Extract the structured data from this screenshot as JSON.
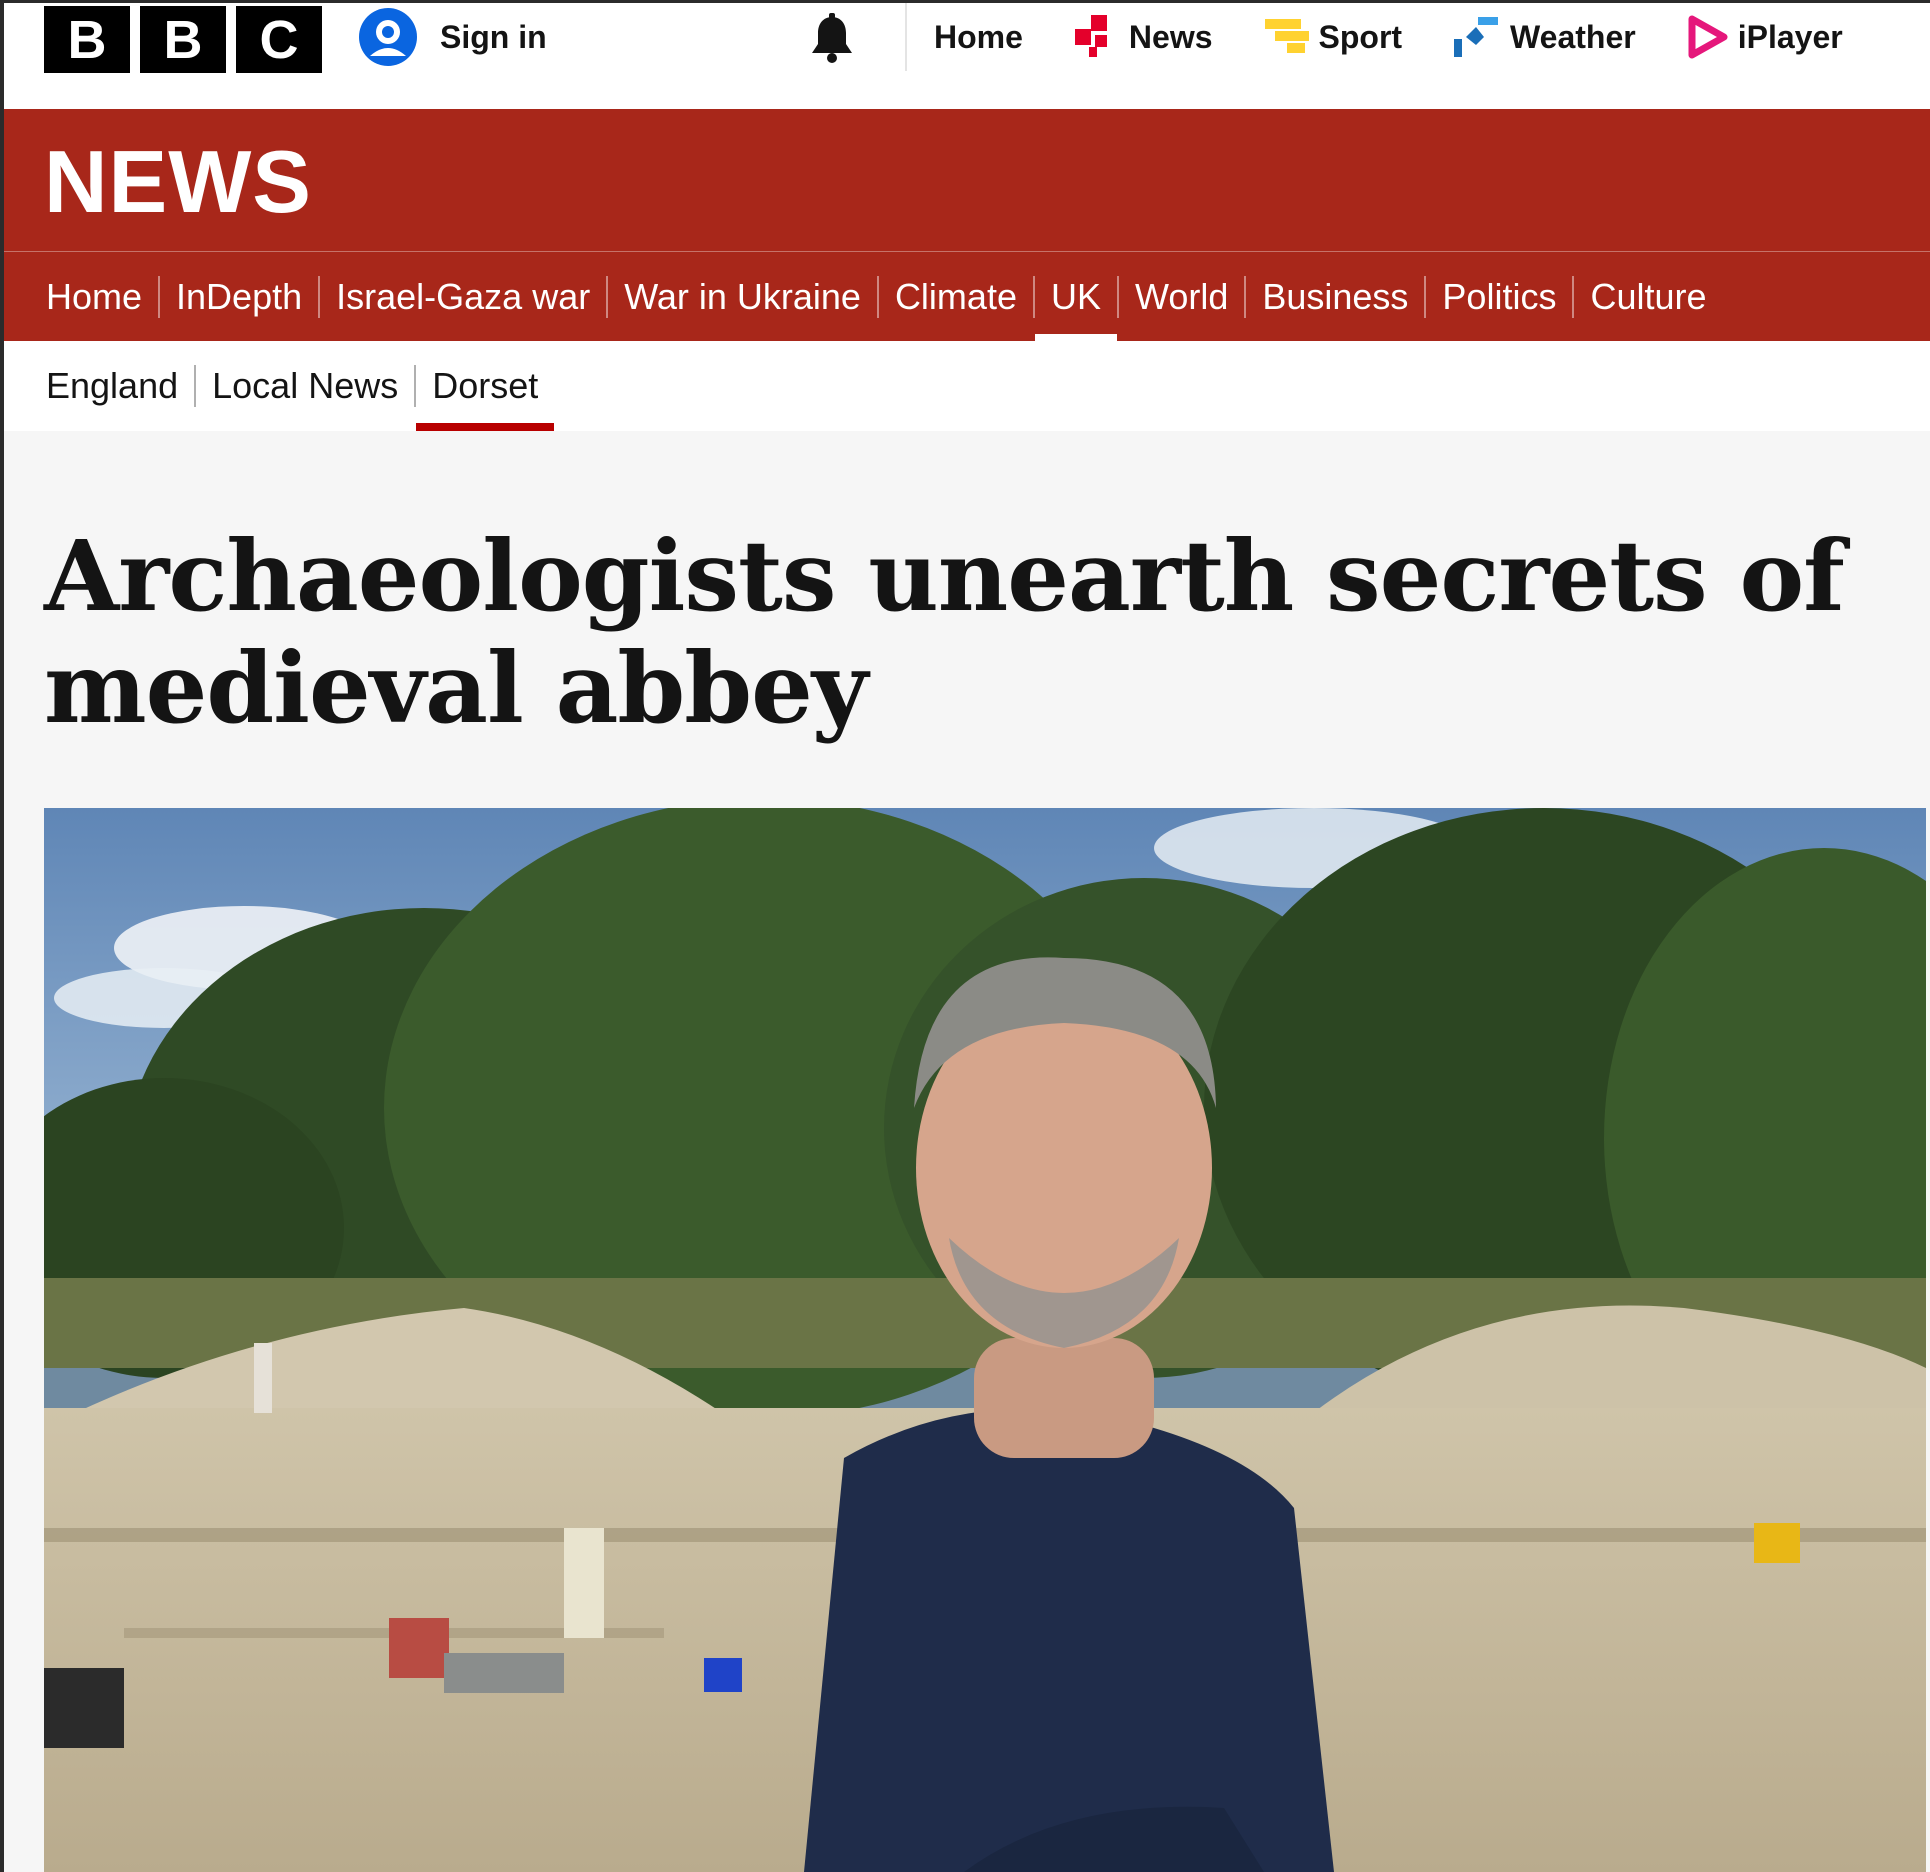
{
  "global_nav": {
    "logo": [
      "B",
      "B",
      "C"
    ],
    "sign_in": "Sign in",
    "links": [
      {
        "label": "Home",
        "icon": "none"
      },
      {
        "label": "News",
        "icon": "news-icon"
      },
      {
        "label": "Sport",
        "icon": "sport-icon"
      },
      {
        "label": "Weather",
        "icon": "weather-icon"
      },
      {
        "label": "iPlayer",
        "icon": "iplayer-icon"
      }
    ]
  },
  "banner": {
    "title": "NEWS",
    "color": "#a8271a"
  },
  "section_nav": {
    "items": [
      "Home",
      "InDepth",
      "Israel-Gaza war",
      "War in Ukraine",
      "Climate",
      "UK",
      "World",
      "Business",
      "Politics",
      "Culture"
    ],
    "active": "UK"
  },
  "sub_nav": {
    "items": [
      "England",
      "Local News",
      "Dorset"
    ],
    "active": "Dorset"
  },
  "article": {
    "headline": "Archaeologists unearth secrets of medieval abbey",
    "image_icon": "photo-excavation-site"
  },
  "colors": {
    "accent_red": "#b80000",
    "brand_black": "#000000",
    "news_red": "#a8271a",
    "sport_yellow": "#ffd230",
    "weather_blue": "#1a6eb8",
    "iplayer_pink": "#e5177b"
  }
}
